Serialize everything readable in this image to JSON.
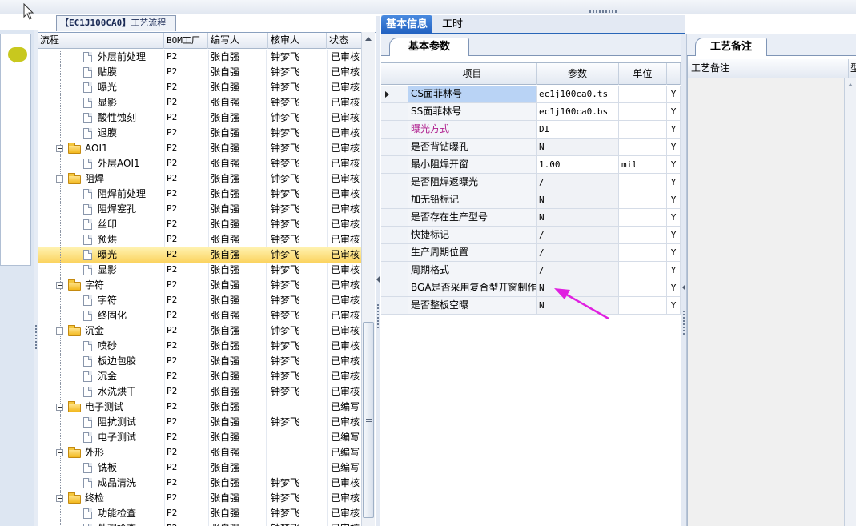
{
  "left_panel": {
    "tab_title_code": "【EC1J100CA0】",
    "tab_title_text": "工艺流程"
  },
  "tree": {
    "columns": [
      "流程",
      "BOM工厂",
      "编写人",
      "核审人",
      "状态"
    ],
    "rows": [
      {
        "name": "外层前处理",
        "level": 2,
        "type": "doc",
        "bom": "P2",
        "writer": "张自强",
        "reviewer": "钟梦飞",
        "status": "已审核"
      },
      {
        "name": "贴膜",
        "level": 2,
        "type": "doc",
        "bom": "P2",
        "writer": "张自强",
        "reviewer": "钟梦飞",
        "status": "已审核"
      },
      {
        "name": "曝光",
        "level": 2,
        "type": "doc",
        "bom": "P2",
        "writer": "张自强",
        "reviewer": "钟梦飞",
        "status": "已审核"
      },
      {
        "name": "显影",
        "level": 2,
        "type": "doc",
        "bom": "P2",
        "writer": "张自强",
        "reviewer": "钟梦飞",
        "status": "已审核"
      },
      {
        "name": "酸性蚀刻",
        "level": 2,
        "type": "doc",
        "bom": "P2",
        "writer": "张自强",
        "reviewer": "钟梦飞",
        "status": "已审核"
      },
      {
        "name": "退膜",
        "level": 2,
        "type": "doc",
        "bom": "P2",
        "writer": "张自强",
        "reviewer": "钟梦飞",
        "status": "已审核"
      },
      {
        "name": "AOI1",
        "level": 1,
        "type": "folder",
        "bom": "P2",
        "writer": "张自强",
        "reviewer": "钟梦飞",
        "status": "已审核"
      },
      {
        "name": "外层AOI1",
        "level": 2,
        "type": "doc",
        "bom": "P2",
        "writer": "张自强",
        "reviewer": "钟梦飞",
        "status": "已审核"
      },
      {
        "name": "阻焊",
        "level": 1,
        "type": "folder",
        "bom": "P2",
        "writer": "张自强",
        "reviewer": "钟梦飞",
        "status": "已审核"
      },
      {
        "name": "阻焊前处理",
        "level": 2,
        "type": "doc",
        "bom": "P2",
        "writer": "张自强",
        "reviewer": "钟梦飞",
        "status": "已审核"
      },
      {
        "name": "阻焊塞孔",
        "level": 2,
        "type": "doc",
        "bom": "P2",
        "writer": "张自强",
        "reviewer": "钟梦飞",
        "status": "已审核"
      },
      {
        "name": "丝印",
        "level": 2,
        "type": "doc",
        "bom": "P2",
        "writer": "张自强",
        "reviewer": "钟梦飞",
        "status": "已审核"
      },
      {
        "name": "预烘",
        "level": 2,
        "type": "doc",
        "bom": "P2",
        "writer": "张自强",
        "reviewer": "钟梦飞",
        "status": "已审核"
      },
      {
        "name": "曝光",
        "level": 2,
        "type": "doc",
        "bom": "P2",
        "writer": "张自强",
        "reviewer": "钟梦飞",
        "status": "已审核",
        "selected": true
      },
      {
        "name": "显影",
        "level": 2,
        "type": "doc",
        "bom": "P2",
        "writer": "张自强",
        "reviewer": "钟梦飞",
        "status": "已审核"
      },
      {
        "name": "字符",
        "level": 1,
        "type": "folder",
        "bom": "P2",
        "writer": "张自强",
        "reviewer": "钟梦飞",
        "status": "已审核"
      },
      {
        "name": "字符",
        "level": 2,
        "type": "doc",
        "bom": "P2",
        "writer": "张自强",
        "reviewer": "钟梦飞",
        "status": "已审核"
      },
      {
        "name": "终固化",
        "level": 2,
        "type": "doc",
        "bom": "P2",
        "writer": "张自强",
        "reviewer": "钟梦飞",
        "status": "已审核"
      },
      {
        "name": "沉金",
        "level": 1,
        "type": "folder",
        "bom": "P2",
        "writer": "张自强",
        "reviewer": "钟梦飞",
        "status": "已审核"
      },
      {
        "name": "喷砂",
        "level": 2,
        "type": "doc",
        "bom": "P2",
        "writer": "张自强",
        "reviewer": "钟梦飞",
        "status": "已审核"
      },
      {
        "name": "板边包胶",
        "level": 2,
        "type": "doc",
        "bom": "P2",
        "writer": "张自强",
        "reviewer": "钟梦飞",
        "status": "已审核"
      },
      {
        "name": "沉金",
        "level": 2,
        "type": "doc",
        "bom": "P2",
        "writer": "张自强",
        "reviewer": "钟梦飞",
        "status": "已审核"
      },
      {
        "name": "水洗烘干",
        "level": 2,
        "type": "doc",
        "bom": "P2",
        "writer": "张自强",
        "reviewer": "钟梦飞",
        "status": "已审核"
      },
      {
        "name": "电子测试",
        "level": 1,
        "type": "folder",
        "bom": "P2",
        "writer": "张自强",
        "reviewer": "",
        "status": "已编写"
      },
      {
        "name": "阻抗测试",
        "level": 2,
        "type": "doc",
        "bom": "P2",
        "writer": "张自强",
        "reviewer": "钟梦飞",
        "status": "已审核"
      },
      {
        "name": "电子测试",
        "level": 2,
        "type": "doc",
        "bom": "P2",
        "writer": "张自强",
        "reviewer": "",
        "status": "已编写"
      },
      {
        "name": "外形",
        "level": 1,
        "type": "folder",
        "bom": "P2",
        "writer": "张自强",
        "reviewer": "",
        "status": "已编写"
      },
      {
        "name": "铣板",
        "level": 2,
        "type": "doc",
        "bom": "P2",
        "writer": "张自强",
        "reviewer": "",
        "status": "已编写"
      },
      {
        "name": "成品清洗",
        "level": 2,
        "type": "doc",
        "bom": "P2",
        "writer": "张自强",
        "reviewer": "钟梦飞",
        "status": "已审核"
      },
      {
        "name": "终检",
        "level": 1,
        "type": "folder",
        "bom": "P2",
        "writer": "张自强",
        "reviewer": "钟梦飞",
        "status": "已审核"
      },
      {
        "name": "功能检查",
        "level": 2,
        "type": "doc",
        "bom": "P2",
        "writer": "张自强",
        "reviewer": "钟梦飞",
        "status": "已审核"
      },
      {
        "name": "外观检查",
        "level": 2,
        "type": "doc",
        "bom": "P2",
        "writer": "张自强",
        "reviewer": "钟梦飞",
        "status": "已审核"
      }
    ]
  },
  "main_tabs": [
    "基本信息",
    "工时"
  ],
  "sub_tab": "基本参数",
  "params": {
    "columns": [
      "项目",
      "参数",
      "单位"
    ],
    "rows": [
      {
        "item": "CS面菲林号",
        "value": "ec1j100ca0.ts",
        "unit": "",
        "flag": "Y",
        "selected": true
      },
      {
        "item": "SS面菲林号",
        "value": "ec1j100ca0.bs",
        "unit": "",
        "flag": "Y"
      },
      {
        "item": "曝光方式",
        "value": "DI",
        "unit": "",
        "flag": "Y",
        "highlight": true
      },
      {
        "item": "是否背钻曝孔",
        "value": "N",
        "unit": "",
        "flag": "Y"
      },
      {
        "item": "最小阻焊开窗",
        "value": "1.00",
        "unit": "mil",
        "flag": "Y"
      },
      {
        "item": "是否阻焊返曝光",
        "value": "/",
        "unit": "",
        "flag": "Y"
      },
      {
        "item": "加无铅标记",
        "value": "N",
        "unit": "",
        "flag": "Y"
      },
      {
        "item": "是否存在生产型号",
        "value": "N",
        "unit": "",
        "flag": "Y"
      },
      {
        "item": "快捷标记",
        "value": "/",
        "unit": "",
        "flag": "Y"
      },
      {
        "item": "生产周期位置",
        "value": "/",
        "unit": "",
        "flag": "Y"
      },
      {
        "item": "周期格式",
        "value": "/",
        "unit": "",
        "flag": "Y"
      },
      {
        "item": "BGA是否采用复合型开窗制作",
        "value": "N",
        "unit": "",
        "flag": "Y"
      },
      {
        "item": "是否整板空曝",
        "value": "N",
        "unit": "",
        "flag": "Y"
      }
    ]
  },
  "notes": {
    "tab": "工艺备注",
    "col1": "工艺备注",
    "col2": "型"
  },
  "colors": {
    "accent": "#1f5fc0",
    "highlight_text": "#b0208f",
    "annotation_arrow": "#e020e0",
    "selected_row": "#fbd35f"
  }
}
